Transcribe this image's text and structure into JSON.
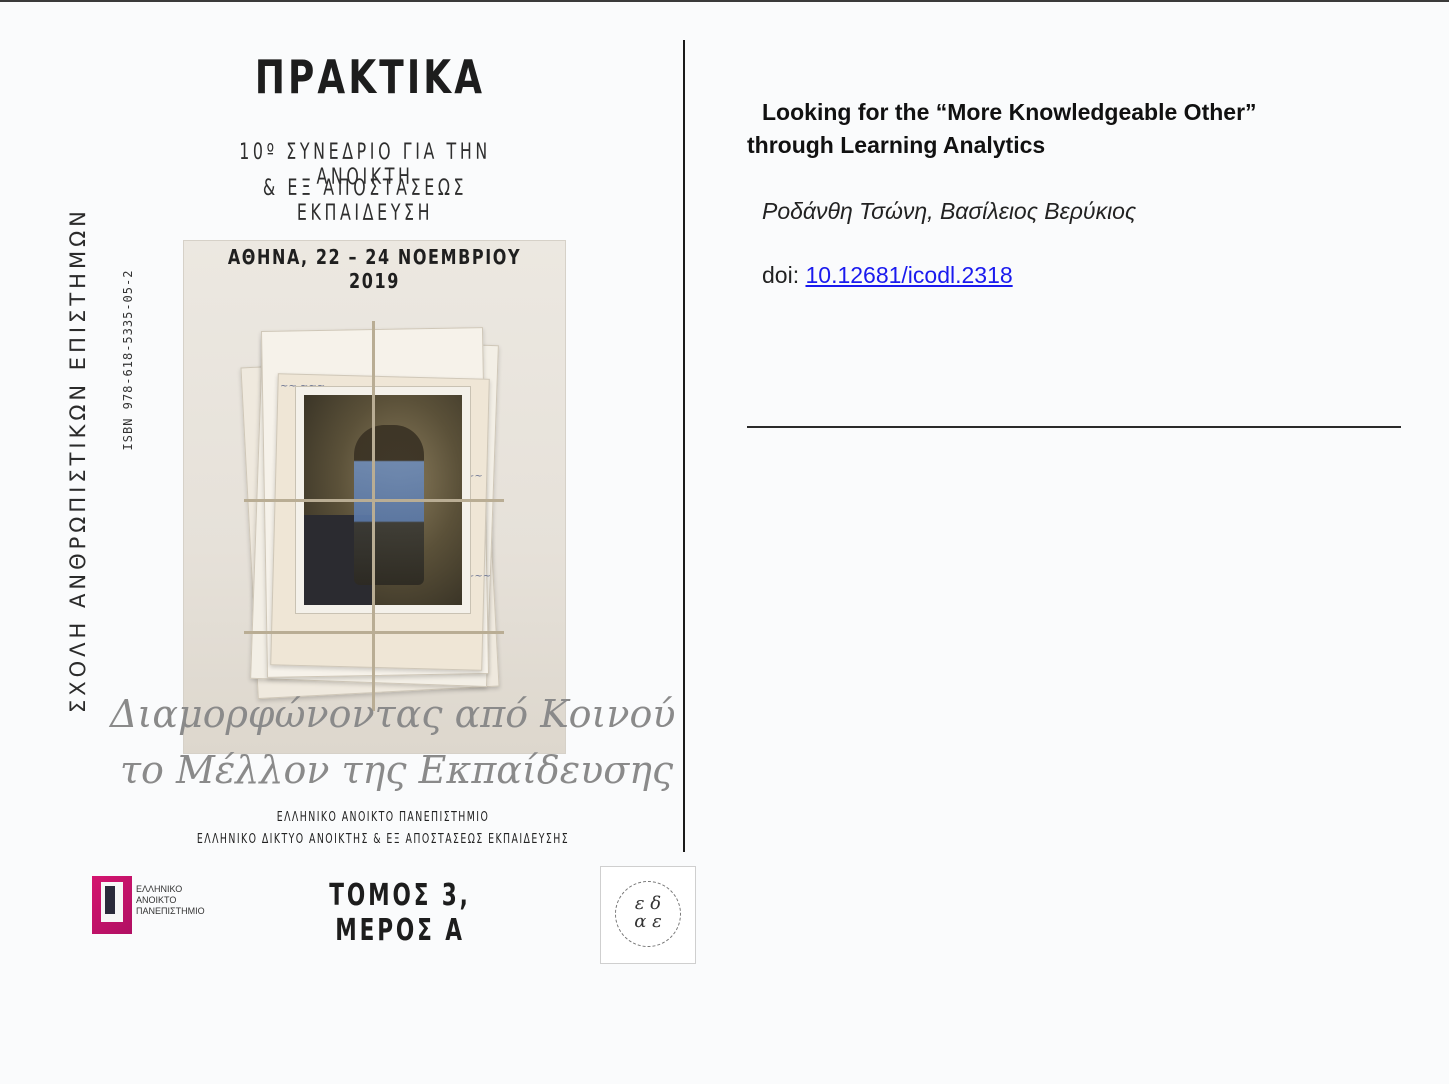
{
  "cover": {
    "title": "ΠΡΑΚΤΙΚΑ",
    "subtitle_line1": "10º ΣΥΝΕΔΡΙΟ ΓΙΑ ΤΗΝ ΑΝΟΙΚΤΗ",
    "subtitle_line2": "& ΕΞ ΑΠΟΣΤΑΣΕΩΣ ΕΚΠΑΙΔΕΥΣΗ",
    "vertical_school": "ΣΧΟΛΗ ΑΝΘΡΩΠΙΣΤΙΚΩΝ ΕΠΙΣΤΗΜΩΝ",
    "vertical_isbn": "ISBN 978-618-5335-05-2",
    "date_place": "ΑΘΗΝΑ, 22 – 24 ΝΟΕΜΒΡΙΟΥ 2019",
    "script_line1": "Διαμορφώνοντας από Κοινού",
    "script_line2": "το Μέλλον της Εκπαίδευσης",
    "publisher_line1": "ΕΛΛΗΝΙΚΟ ΑΝΟΙΚΤΟ ΠΑΝΕΠΙΣΤΗΜΙΟ",
    "publisher_line2": "ΕΛΛΗΝΙΚΟ ΔΙΚΤΥΟ ΑΝΟΙΚΤΗΣ & ΕΞ ΑΠΟΣΤΑΣΕΩΣ ΕΚΠΑΙΔΕΥΣΗΣ",
    "logo_eap_text": "ΕΛΛΗΝΙΚΟ\nΑΝΟΙΚΤΟ\nΠΑΝΕΠΙΣΤΗΜΙΟ",
    "volume": "ΤΟΜΟΣ 3, ΜΕΡΟΣ Α",
    "logo_edae_glyphs": "ε δ\nα ε",
    "colors": {
      "eap_magenta": "#d4146f",
      "ink": "#1d1d1d"
    }
  },
  "article": {
    "title_line1": "Looking for the “More Knowledgeable Other”",
    "title_line2": "through Learning Analytics",
    "authors": "Ροδάνθη Τσώνη, Βασίλειος Βερύκιος",
    "doi_label": "doi: ",
    "doi_value": "10.12681/icodl.2318",
    "link_color": "#1a1aee"
  }
}
